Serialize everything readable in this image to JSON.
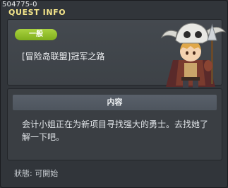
{
  "window": {
    "id_label": "504775-0",
    "title": "QUEST INFO"
  },
  "quest": {
    "category": "一般",
    "name": "[冒险岛联盟]冠军之路",
    "npc_icon": "skull-helmet-warrior-portrait"
  },
  "content": {
    "header": "内容",
    "description": "会计小姐正在为新项目寻找强大的勇士。去找她了解一下吧。"
  },
  "status": {
    "text": "狀態: 可開始"
  },
  "colors": {
    "title": "#f4e58a",
    "badge": "#8fbe26",
    "panel": "#3d4247"
  }
}
